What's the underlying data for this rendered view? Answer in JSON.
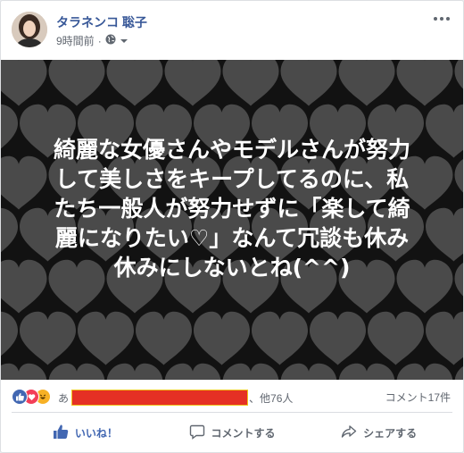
{
  "post": {
    "author": "タラネンコ 聡子",
    "timestamp": "9時間前",
    "separator": "·",
    "privacy_icon": "globe-icon",
    "menu_icon": "more-dots-icon"
  },
  "image": {
    "background_color": "#121212",
    "heart_color": "#4a4a4a",
    "lines": [
      "綺麗な女優さんやモデルさんが努力",
      "して美しさをキープしてるのに、私",
      "たち一般人が努力せずに「楽して綺",
      "麗になりたい♡」なんて冗談も休み",
      "休みにしないとね(^^)"
    ]
  },
  "reactions": {
    "icons": [
      "like-icon",
      "love-icon",
      "haha-icon"
    ],
    "prefix": "あ",
    "suffix": "、他76人",
    "comments": "コメント17件"
  },
  "actions": {
    "like": "いいね！",
    "comment": "コメントする",
    "share": "シェアする"
  },
  "colors": {
    "link": "#385898",
    "like_blue": "#4267b2",
    "love_red": "#f33e58",
    "haha_yellow": "#f7b125",
    "redaction": "#e53024"
  }
}
